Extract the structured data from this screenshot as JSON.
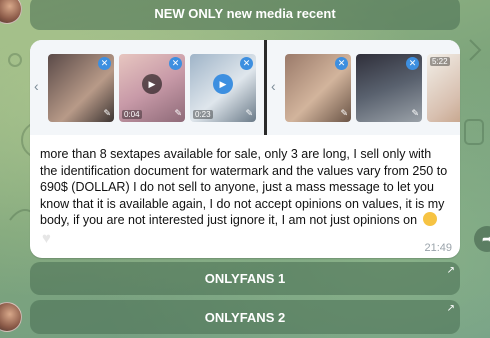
{
  "buttons": {
    "top": "NEW ONLY new media recent",
    "one": "ONLYFANS 1",
    "two": "ONLYFANS 2"
  },
  "media": {
    "left": [
      {
        "icon": "close-icon",
        "duration": ""
      },
      {
        "icon": "play-icon",
        "duration": "0:04"
      },
      {
        "icon": "play-icon",
        "duration": "0:23"
      }
    ],
    "right": [
      {
        "icon": "close-icon",
        "duration": ""
      },
      {
        "icon": "close-icon",
        "duration": ""
      },
      {
        "icon": "close-icon",
        "duration": "5:22"
      }
    ]
  },
  "message": {
    "text": "more than 8 sextapes available for sale, only 3 are long, I sell only with the identification document for watermark and the values vary from 250 to 690$ (DOLLAR) I do not sell to anyone, just a mass message to let you know that it is available again, I do not accept opinions on values, it is my body, if you are not interested just ignore it, I am not just opinions on",
    "time": "21:49"
  },
  "colors": {
    "accent": "#3d8fe0",
    "button_bg": "#486e52"
  }
}
